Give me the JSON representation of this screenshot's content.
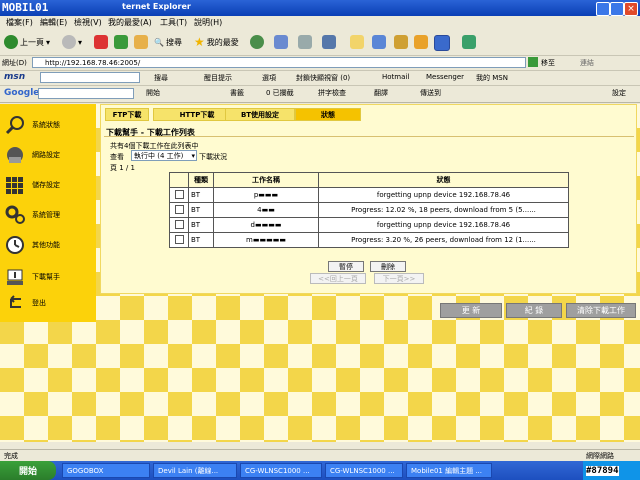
{
  "window": {
    "logo": "MOBIL01",
    "title": "ternet Explorer"
  },
  "menu": [
    "檔案(F)",
    "編輯(E)",
    "檢視(V)",
    "我的最愛(A)",
    "工具(T)",
    "說明(H)"
  ],
  "toolbar": {
    "back": "上一頁",
    "search": "搜尋",
    "favorites": "我的最愛"
  },
  "address": {
    "label": "網址(D)",
    "url": "http://192.168.78.46:2005/",
    "go": "移至",
    "links": "連結"
  },
  "msnbar": {
    "brand": "msn",
    "search": "搜尋",
    "highlight": "醒目提示",
    "options": "選項",
    "popup": "封鎖快顯視窗 (0)",
    "hotmail": "Hotmail",
    "messenger": "Messenger",
    "mymsn": "我的 MSN"
  },
  "googlebar": {
    "brand": "Google",
    "go": "開始",
    "bookmarks": "書籤",
    "blocked": "0 已攔截",
    "spell": "拼字檢查",
    "translate": "翻譯",
    "send": "傳送到",
    "settings": "設定"
  },
  "sidebar": {
    "items": [
      {
        "label": "系統狀態",
        "icon": "magnifier-icon"
      },
      {
        "label": "網路設定",
        "icon": "network-icon"
      },
      {
        "label": "儲存設定",
        "icon": "storage-icon"
      },
      {
        "label": "系統管理",
        "icon": "gears-icon"
      },
      {
        "label": "其他功能",
        "icon": "clock-icon"
      },
      {
        "label": "下載幫手",
        "icon": "download-icon"
      },
      {
        "label": "登出",
        "icon": "logout-arrow-icon"
      }
    ]
  },
  "tabs": [
    {
      "label": "FTP下載"
    },
    {
      "label": "HTTP下載"
    },
    {
      "label": "BT使用設定"
    },
    {
      "label": "狀態"
    }
  ],
  "panel": {
    "title": "下載幫手 - 下載工作列表",
    "count": "共有4個下載工作在此列表中",
    "filter_label": "查看",
    "filter_value": "執行中 (4 工作)",
    "filter_suffix": "下載狀況",
    "pager": "頁 1 / 1"
  },
  "table": {
    "headers": [
      "",
      "種類",
      "工作名稱",
      "狀態"
    ],
    "rows": [
      {
        "type": "BT",
        "name": "p▬▬▬",
        "status": "forgetting upnp device 192.168.78.46"
      },
      {
        "type": "BT",
        "name": "4▬▬",
        "status": "Progress: 12.02 %, 18 peers, download from 5 (5......"
      },
      {
        "type": "BT",
        "name": "d▬▬▬▬",
        "status": "forgetting upnp device 192.168.78.46"
      },
      {
        "type": "BT",
        "name": "m▬▬▬▬▬",
        "status": "Progress: 3.20 %, 26 peers, download from 12 (1......"
      }
    ]
  },
  "actions": {
    "pause": "暫停",
    "delete": "刪除",
    "prev": "<<回上一頁",
    "next": "下一頁>>"
  },
  "bigbuttons": {
    "refresh": "更 新",
    "log": "紀 錄",
    "clear": "清除下載工作"
  },
  "statusbar": {
    "left": "完成",
    "right": "網際網路"
  },
  "taskbar": {
    "start": "開始",
    "tasks": [
      "GOGOBOX",
      "Devil Lain (離線...",
      "CG-WLNSC1000 ...",
      "CG-WLNSC1000 ...",
      "Mobile01 編輯主題 ..."
    ]
  },
  "watermark": "#87894",
  "colors": {
    "sidebar": "#fcd20a",
    "panel": "#fffbd0",
    "active_tab": "#f5c200",
    "titlebar": "#0a3fb5"
  }
}
